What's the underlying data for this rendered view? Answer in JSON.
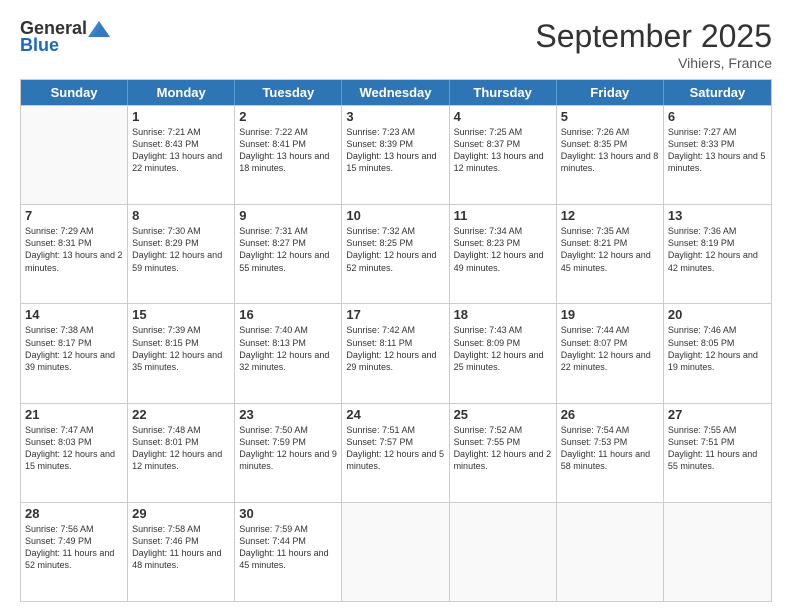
{
  "logo": {
    "general": "General",
    "blue": "Blue",
    "tagline": ""
  },
  "header": {
    "month_year": "September 2025",
    "location": "Vihiers, France"
  },
  "days_of_week": [
    "Sunday",
    "Monday",
    "Tuesday",
    "Wednesday",
    "Thursday",
    "Friday",
    "Saturday"
  ],
  "weeks": [
    [
      {
        "day": "",
        "empty": true
      },
      {
        "day": "1",
        "sunrise": "7:21 AM",
        "sunset": "8:43 PM",
        "daylight": "13 hours and 22 minutes."
      },
      {
        "day": "2",
        "sunrise": "7:22 AM",
        "sunset": "8:41 PM",
        "daylight": "13 hours and 18 minutes."
      },
      {
        "day": "3",
        "sunrise": "7:23 AM",
        "sunset": "8:39 PM",
        "daylight": "13 hours and 15 minutes."
      },
      {
        "day": "4",
        "sunrise": "7:25 AM",
        "sunset": "8:37 PM",
        "daylight": "13 hours and 12 minutes."
      },
      {
        "day": "5",
        "sunrise": "7:26 AM",
        "sunset": "8:35 PM",
        "daylight": "13 hours and 8 minutes."
      },
      {
        "day": "6",
        "sunrise": "7:27 AM",
        "sunset": "8:33 PM",
        "daylight": "13 hours and 5 minutes."
      }
    ],
    [
      {
        "day": "7",
        "sunrise": "7:29 AM",
        "sunset": "8:31 PM",
        "daylight": "13 hours and 2 minutes."
      },
      {
        "day": "8",
        "sunrise": "7:30 AM",
        "sunset": "8:29 PM",
        "daylight": "12 hours and 59 minutes."
      },
      {
        "day": "9",
        "sunrise": "7:31 AM",
        "sunset": "8:27 PM",
        "daylight": "12 hours and 55 minutes."
      },
      {
        "day": "10",
        "sunrise": "7:32 AM",
        "sunset": "8:25 PM",
        "daylight": "12 hours and 52 minutes."
      },
      {
        "day": "11",
        "sunrise": "7:34 AM",
        "sunset": "8:23 PM",
        "daylight": "12 hours and 49 minutes."
      },
      {
        "day": "12",
        "sunrise": "7:35 AM",
        "sunset": "8:21 PM",
        "daylight": "12 hours and 45 minutes."
      },
      {
        "day": "13",
        "sunrise": "7:36 AM",
        "sunset": "8:19 PM",
        "daylight": "12 hours and 42 minutes."
      }
    ],
    [
      {
        "day": "14",
        "sunrise": "7:38 AM",
        "sunset": "8:17 PM",
        "daylight": "12 hours and 39 minutes."
      },
      {
        "day": "15",
        "sunrise": "7:39 AM",
        "sunset": "8:15 PM",
        "daylight": "12 hours and 35 minutes."
      },
      {
        "day": "16",
        "sunrise": "7:40 AM",
        "sunset": "8:13 PM",
        "daylight": "12 hours and 32 minutes."
      },
      {
        "day": "17",
        "sunrise": "7:42 AM",
        "sunset": "8:11 PM",
        "daylight": "12 hours and 29 minutes."
      },
      {
        "day": "18",
        "sunrise": "7:43 AM",
        "sunset": "8:09 PM",
        "daylight": "12 hours and 25 minutes."
      },
      {
        "day": "19",
        "sunrise": "7:44 AM",
        "sunset": "8:07 PM",
        "daylight": "12 hours and 22 minutes."
      },
      {
        "day": "20",
        "sunrise": "7:46 AM",
        "sunset": "8:05 PM",
        "daylight": "12 hours and 19 minutes."
      }
    ],
    [
      {
        "day": "21",
        "sunrise": "7:47 AM",
        "sunset": "8:03 PM",
        "daylight": "12 hours and 15 minutes."
      },
      {
        "day": "22",
        "sunrise": "7:48 AM",
        "sunset": "8:01 PM",
        "daylight": "12 hours and 12 minutes."
      },
      {
        "day": "23",
        "sunrise": "7:50 AM",
        "sunset": "7:59 PM",
        "daylight": "12 hours and 9 minutes."
      },
      {
        "day": "24",
        "sunrise": "7:51 AM",
        "sunset": "7:57 PM",
        "daylight": "12 hours and 5 minutes."
      },
      {
        "day": "25",
        "sunrise": "7:52 AM",
        "sunset": "7:55 PM",
        "daylight": "12 hours and 2 minutes."
      },
      {
        "day": "26",
        "sunrise": "7:54 AM",
        "sunset": "7:53 PM",
        "daylight": "11 hours and 58 minutes."
      },
      {
        "day": "27",
        "sunrise": "7:55 AM",
        "sunset": "7:51 PM",
        "daylight": "11 hours and 55 minutes."
      }
    ],
    [
      {
        "day": "28",
        "sunrise": "7:56 AM",
        "sunset": "7:49 PM",
        "daylight": "11 hours and 52 minutes."
      },
      {
        "day": "29",
        "sunrise": "7:58 AM",
        "sunset": "7:46 PM",
        "daylight": "11 hours and 48 minutes."
      },
      {
        "day": "30",
        "sunrise": "7:59 AM",
        "sunset": "7:44 PM",
        "daylight": "11 hours and 45 minutes."
      },
      {
        "day": "",
        "empty": true
      },
      {
        "day": "",
        "empty": true
      },
      {
        "day": "",
        "empty": true
      },
      {
        "day": "",
        "empty": true
      }
    ]
  ]
}
